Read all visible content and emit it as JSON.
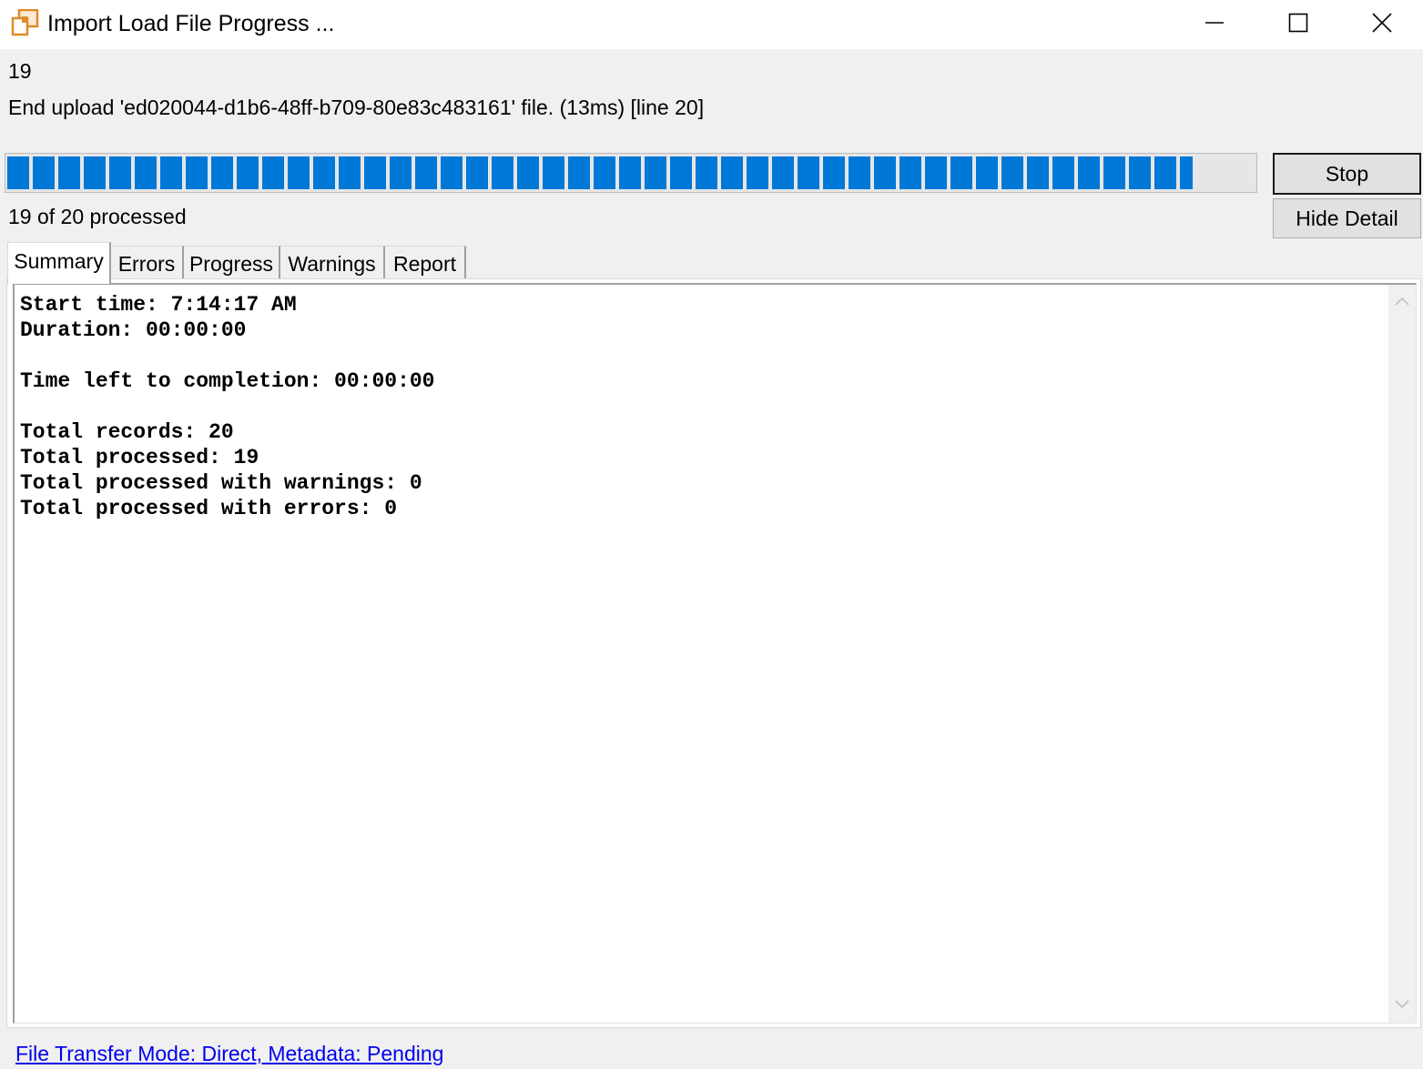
{
  "window": {
    "title": "Import Load File Progress ...",
    "app_icon": "import-load-file-icon",
    "controls": {
      "minimize_icon": "minimize-icon",
      "maximize_icon": "maximize-icon",
      "close_icon": "close-icon"
    }
  },
  "status": {
    "current_count": "19",
    "message": "End upload 'ed020044-d1b6-48ff-b709-80e83c483161' file. (13ms) [line 20]",
    "processed_text": "19 of 20 processed",
    "progress_fraction": 0.95,
    "progress_color": "#0078d7"
  },
  "buttons": {
    "stop": "Stop",
    "hide_detail": "Hide Detail"
  },
  "tabs": [
    {
      "label": "Summary",
      "active": true
    },
    {
      "label": "Errors",
      "active": false
    },
    {
      "label": "Progress",
      "active": false
    },
    {
      "label": "Warnings",
      "active": false
    },
    {
      "label": "Report",
      "active": false
    }
  ],
  "summary": {
    "start_time": "Start time: 7:14:17 AM",
    "duration": "Duration: 00:00:00",
    "time_left": "Time left to completion: 00:00:00",
    "total_records": "Total records: 20",
    "total_processed": "Total processed: 19",
    "total_warnings": "Total processed with warnings: 0",
    "total_errors": "Total processed with errors: 0"
  },
  "footer": {
    "link_text": "File Transfer Mode: Direct, Metadata: Pending",
    "link_color": "#0000ee"
  }
}
